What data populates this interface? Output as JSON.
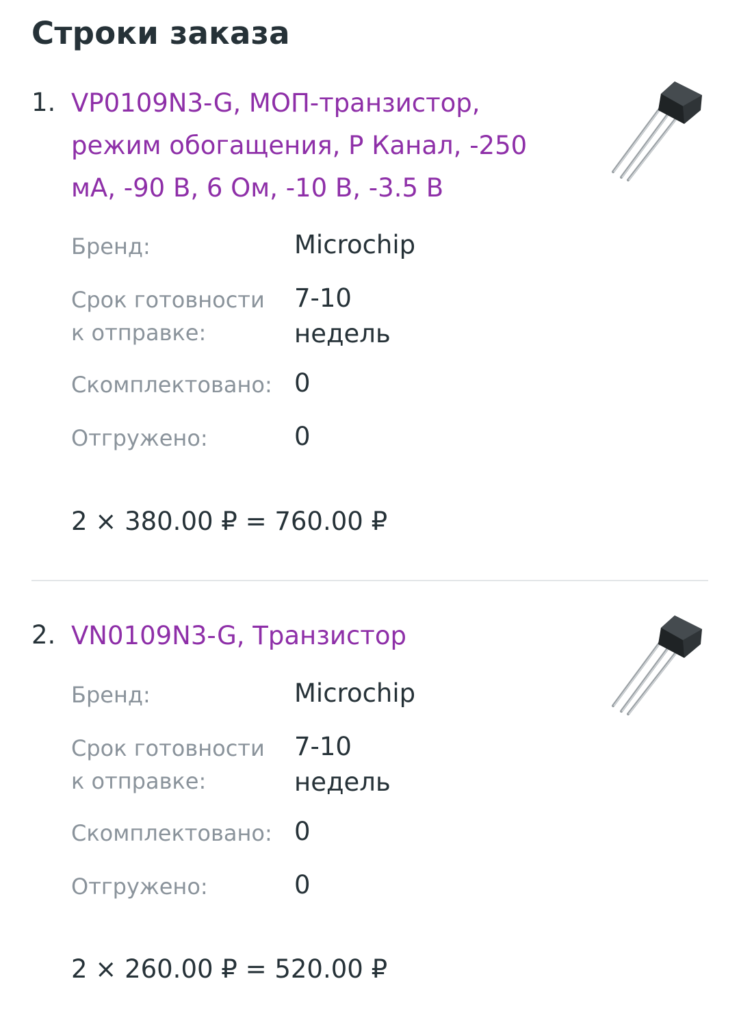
{
  "section": {
    "title": "Строки заказа"
  },
  "colors": {
    "link": "#8e2fa8",
    "label": "#8a939b",
    "text": "#263238",
    "divider": "#e3e6e8"
  },
  "items": [
    {
      "number": "1.",
      "name": "VP0109N3-G, МОП-транзистор, режим обогащения, P Канал, -250 мА, -90 В, 6 Ом, -10 В, -3.5 В",
      "image": "transistor-to92-icon",
      "brand_label": "Бренд:",
      "brand_value": "Microchip",
      "lead_label": "Срок готовности к отправке:",
      "lead_value": "7-10 недель",
      "packed_label": "Скомплектовано:",
      "packed_value": "0",
      "shipped_label": "Отгружено:",
      "shipped_value": "0",
      "total": "2 × 380.00 ₽ = 760.00 ₽"
    },
    {
      "number": "2.",
      "name": "VN0109N3-G, Транзистор",
      "image": "transistor-to92-icon",
      "brand_label": "Бренд:",
      "brand_value": "Microchip",
      "lead_label": "Срок готовности к отправке:",
      "lead_value": "7-10 недель",
      "packed_label": "Скомплектовано:",
      "packed_value": "0",
      "shipped_label": "Отгружено:",
      "shipped_value": "0",
      "total": "2 × 260.00 ₽ = 520.00 ₽"
    }
  ]
}
